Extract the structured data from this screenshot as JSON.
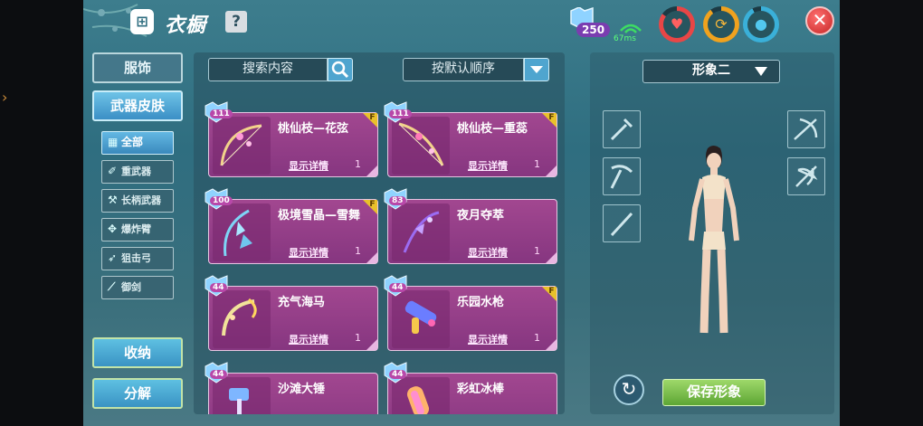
{
  "window": {
    "title": "衣橱",
    "help": "?",
    "close": "✕"
  },
  "status": {
    "gem_count": "250",
    "ping": "67ms",
    "stats": [
      {
        "name": "heart",
        "color": "#e84646",
        "icon": "♥"
      },
      {
        "name": "stamina",
        "color": "#f0a21e",
        "icon": "⟳"
      },
      {
        "name": "water",
        "color": "#3ab0d9",
        "icon": "●"
      }
    ]
  },
  "main_tabs": [
    {
      "label": "服饰",
      "active": false
    },
    {
      "label": "武器皮肤",
      "active": true
    }
  ],
  "sub_tabs": [
    {
      "label": "全部",
      "icon": "grid-icon",
      "active": true
    },
    {
      "label": "重武器",
      "icon": "hammer-icon",
      "active": false
    },
    {
      "label": "长柄武器",
      "icon": "polearm-icon",
      "active": false
    },
    {
      "label": "爆炸臂",
      "icon": "blast-arm-icon",
      "active": false
    },
    {
      "label": "狙击弓",
      "icon": "bow-icon",
      "active": false
    },
    {
      "label": "御剑",
      "icon": "sword-icon",
      "active": false
    }
  ],
  "actions": {
    "store": "收纳",
    "decompose": "分解"
  },
  "search": {
    "placeholder": "搜索内容"
  },
  "sort": {
    "selected": "按默认顺序"
  },
  "cards": [
    {
      "name": "桃仙枝—花弦",
      "level": "111",
      "detail": "显示详情",
      "qty": "1",
      "fbadge": "F",
      "weapon": "bow"
    },
    {
      "name": "桃仙枝—重蕊",
      "level": "111",
      "detail": "显示详情",
      "qty": "1",
      "fbadge": "F",
      "weapon": "bow"
    },
    {
      "name": "极境雪晶—雪舞",
      "level": "100",
      "detail": "显示详情",
      "qty": "1",
      "fbadge": "F",
      "weapon": "crystal-bow"
    },
    {
      "name": "夜月夺萃",
      "level": "83",
      "detail": "显示详情",
      "qty": "1",
      "fbadge": "",
      "weapon": "purple-bow"
    },
    {
      "name": "充气海马",
      "level": "44",
      "detail": "显示详情",
      "qty": "1",
      "fbadge": "",
      "weapon": "seahorse"
    },
    {
      "name": "乐园水枪",
      "level": "44",
      "detail": "显示详情",
      "qty": "1",
      "fbadge": "F",
      "weapon": "water-gun"
    },
    {
      "name": "沙滩大锤",
      "level": "44",
      "detail": "",
      "qty": "",
      "fbadge": "",
      "weapon": "hammer"
    },
    {
      "name": "彩虹冰棒",
      "level": "44",
      "detail": "",
      "qty": "",
      "fbadge": "",
      "weapon": "popsicle"
    }
  ],
  "look": {
    "selected": "形象二",
    "save": "保存形象",
    "refresh": "↻"
  }
}
